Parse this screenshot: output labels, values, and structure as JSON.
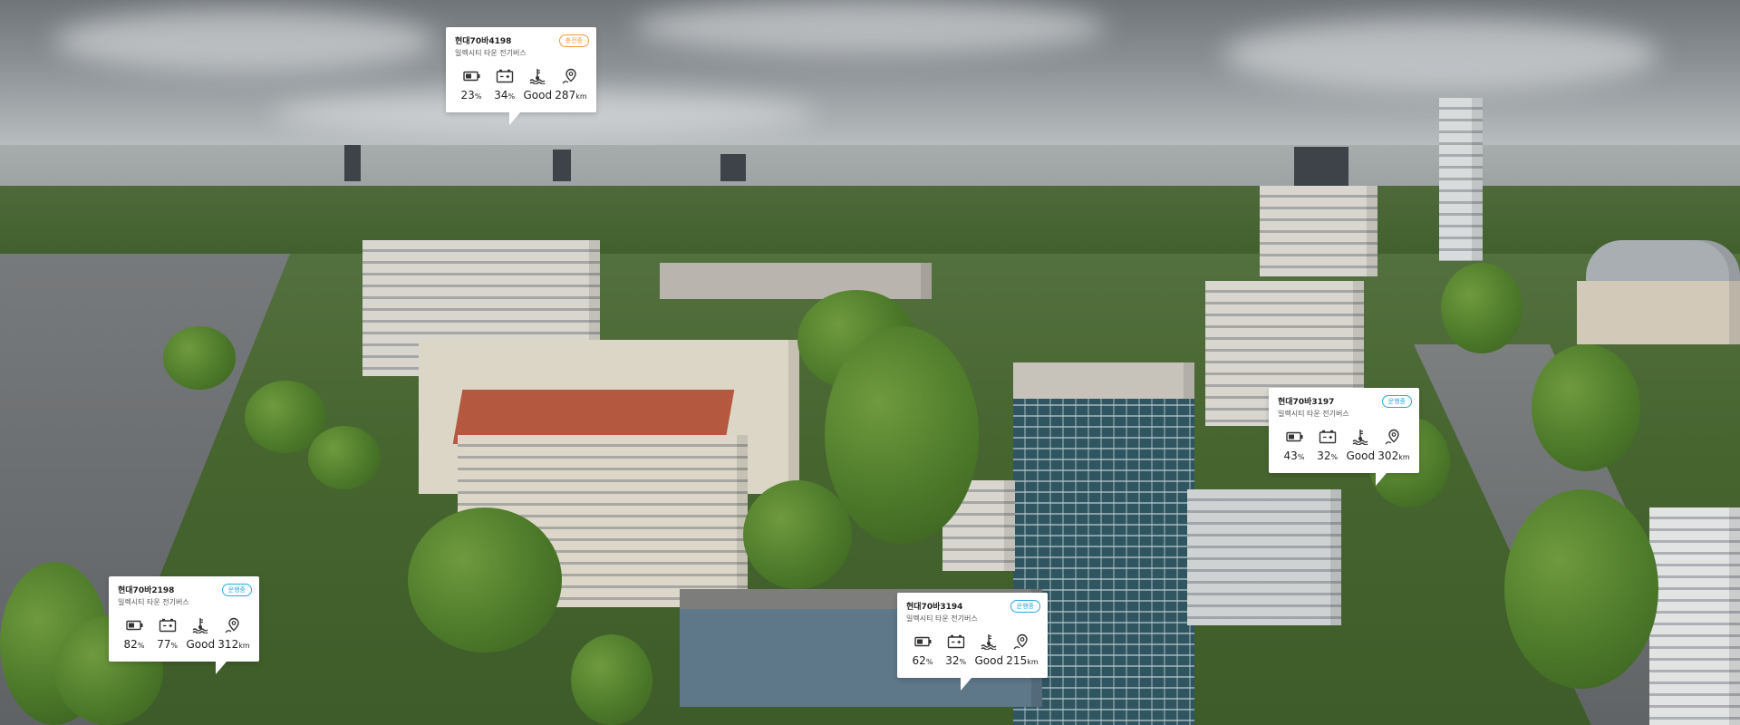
{
  "cards": [
    {
      "plate": "현대70바4198",
      "model": "일렉시티 타운 전기버스",
      "status": "충전중",
      "status_color": "#f29a3d",
      "battery": "23",
      "battery_unit": "%",
      "charge": "34",
      "charge_unit": "%",
      "cooling": "Good",
      "range": "287",
      "range_unit": "km"
    },
    {
      "plate": "현대70바2198",
      "model": "일렉시티 타운 전기버스",
      "status": "운행중",
      "status_color": "#2aa9d8",
      "battery": "82",
      "battery_unit": "%",
      "charge": "77",
      "charge_unit": "%",
      "cooling": "Good",
      "range": "312",
      "range_unit": "km"
    },
    {
      "plate": "현대70바3194",
      "model": "일렉시티 타운 전기버스",
      "status": "운행중",
      "status_color": "#2aa9d8",
      "battery": "62",
      "battery_unit": "%",
      "charge": "32",
      "charge_unit": "%",
      "cooling": "Good",
      "range": "215",
      "range_unit": "km"
    },
    {
      "plate": "현대70바3197",
      "model": "일렉시티 타운 전기버스",
      "status": "운행중",
      "status_color": "#2aa9d8",
      "battery": "43",
      "battery_unit": "%",
      "charge": "32",
      "charge_unit": "%",
      "cooling": "Good",
      "range": "302",
      "range_unit": "km"
    }
  ],
  "icons": {
    "battery": "battery-icon",
    "charge": "charger-icon",
    "cooling": "coolant-icon",
    "range": "location-pin-icon"
  },
  "colors": {
    "card_bg": "#ffffff",
    "text": "#222222",
    "charging": "#f29a3d",
    "running": "#2aa9d8"
  }
}
